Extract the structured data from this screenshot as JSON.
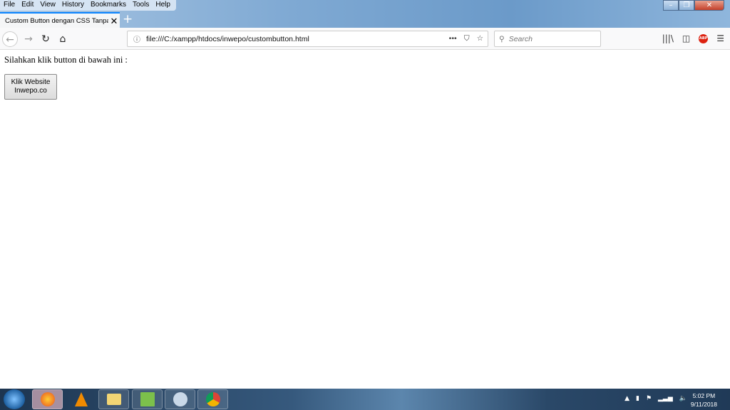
{
  "menu": [
    "File",
    "Edit",
    "View",
    "History",
    "Bookmarks",
    "Tools",
    "Help"
  ],
  "tab": {
    "title": "Custom Button dengan CSS Tanpa Gambar"
  },
  "url": "file:///C:/xampp/htdocs/inwepo/custombutton.html",
  "search_placeholder": "Search",
  "page": {
    "text": "Silahkan klik button di bawah ini :",
    "button_line1": "Klik Website",
    "button_line2": "Inwepo.co"
  },
  "taskbar": {
    "apps": [
      "firefox",
      "vlc",
      "file-explorer",
      "notepad",
      "paint",
      "chrome"
    ],
    "time": "5:02 PM",
    "date": "9/11/2018"
  }
}
